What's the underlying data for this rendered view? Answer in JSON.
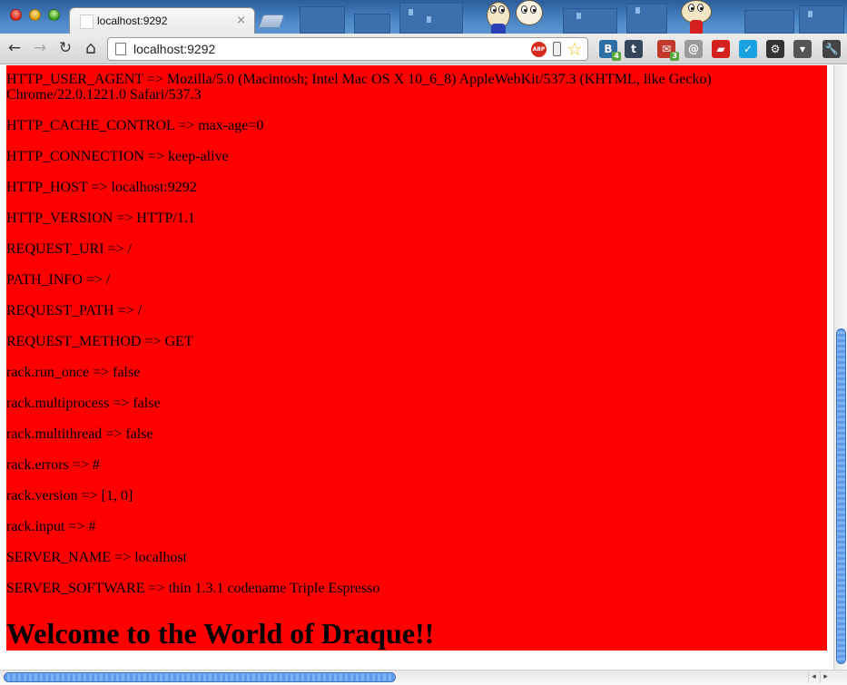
{
  "browser": {
    "tab": {
      "title": "localhost:9292",
      "close_glyph": "×"
    },
    "toolbar": {
      "back_icon": "←",
      "forward_icon": "→",
      "reload_icon": "↻",
      "home_icon": "⌂",
      "url": "localhost:9292",
      "abp_label": "ABP",
      "star_icon": "☆",
      "extensions": [
        {
          "name": "bitly-icon",
          "color": "#2e6ea6",
          "label": "B",
          "badge": "4"
        },
        {
          "name": "tumblr-icon",
          "color": "#35465c",
          "label": "t"
        },
        {
          "name": "mail-icon",
          "color": "#c0392b",
          "label": "✉",
          "badge": "3"
        },
        {
          "name": "note-icon",
          "color": "#9a9a9a",
          "label": "@"
        },
        {
          "name": "sofa-icon",
          "color": "#d62020",
          "label": "▰"
        },
        {
          "name": "check-icon",
          "color": "#1aa1e1",
          "label": "✓"
        },
        {
          "name": "gear-icon",
          "color": "#333333",
          "label": "⚙"
        },
        {
          "name": "pocket-icon",
          "color": "#555555",
          "label": "▾"
        },
        {
          "name": "wrench-icon",
          "color": "#444444",
          "label": "🔧"
        }
      ]
    }
  },
  "page": {
    "env_lines": [
      "HTTP_USER_AGENT => Mozilla/5.0 (Macintosh; Intel Mac OS X 10_6_8) AppleWebKit/537.3 (KHTML, like Gecko) Chrome/22.0.1221.0 Safari/537.3",
      "HTTP_CACHE_CONTROL => max-age=0",
      "HTTP_CONNECTION => keep-alive",
      "HTTP_HOST => localhost:9292",
      "HTTP_VERSION => HTTP/1.1",
      "REQUEST_URI => /",
      "PATH_INFO => /",
      "REQUEST_PATH => /",
      "REQUEST_METHOD => GET",
      "rack.run_once => false",
      "rack.multiprocess => false",
      "rack.multithread => false",
      "rack.errors => #",
      "rack.version => [1, 0]",
      "rack.input => #",
      "SERVER_NAME => localhost",
      "SERVER_SOFTWARE => thin 1.3.1 codename Triple Espresso"
    ],
    "heading": "Welcome to the World of Draque!!",
    "background_color": "#ff0000"
  },
  "scrollbars": {
    "left_arrow": "◂",
    "right_arrow": "▸"
  }
}
